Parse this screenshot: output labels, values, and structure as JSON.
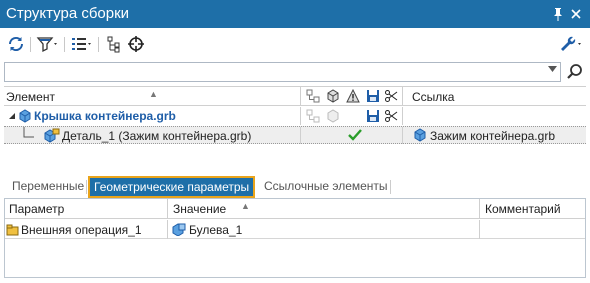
{
  "window": {
    "title": "Структура сборки",
    "pin_glyph": "🖈",
    "close_glyph": "✕"
  },
  "toolbar": {
    "icons": [
      "refresh-icon",
      "filter-icon",
      "list-filter-icon",
      "tree-structure-icon",
      "target-crosshair-icon",
      "settings-wrench-icon"
    ]
  },
  "search": {
    "value": "",
    "placeholder": ""
  },
  "tree": {
    "columns": {
      "element": "Элемент",
      "sort_glyph": "▲",
      "reference": "Ссылка"
    },
    "rows": [
      {
        "name": "Крышка контейнера.grb",
        "expanded": true,
        "reference": ""
      },
      {
        "name": "Деталь_1 (Зажим контейнера.grb)",
        "checked": true,
        "reference": "Зажим контейнера.grb"
      }
    ]
  },
  "tabs": [
    {
      "label": "Переменные",
      "active": false
    },
    {
      "label": "Геометрические параметры",
      "active": true
    },
    {
      "label": "Ссылочные элементы",
      "active": false
    }
  ],
  "grid": {
    "columns": {
      "parameter": "Параметр",
      "value": "Значение",
      "sort_glyph": "▲",
      "comment": "Комментарий"
    },
    "rows": [
      {
        "parameter": "Внешняя операция_1",
        "value": "Булева_1",
        "comment": ""
      }
    ]
  },
  "colors": {
    "titlebar": "#1e6fa8",
    "link_blue": "#1f5ea8",
    "tab_highlight": "#e9a41b",
    "check_green": "#2a9d2a"
  }
}
